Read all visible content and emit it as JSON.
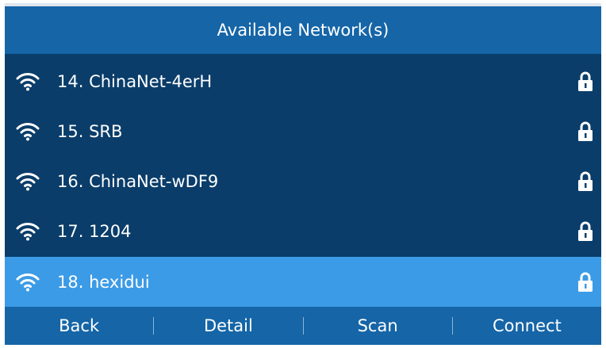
{
  "header": {
    "title": "Available Network(s)"
  },
  "networks": [
    {
      "label": "14.  ChinaNet-4erH",
      "icon": "wifi-icon",
      "secured": true
    },
    {
      "label": "15.  SRB",
      "icon": "wifi-icon",
      "secured": true
    },
    {
      "label": "16.  ChinaNet-wDF9",
      "icon": "wifi-icon",
      "secured": true
    },
    {
      "label": "17.  1204",
      "icon": "wifi-icon",
      "secured": true
    },
    {
      "label": "18.  hexidui",
      "icon": "wifi-icon",
      "secured": true,
      "selected": true
    }
  ],
  "softkeys": {
    "back": "Back",
    "detail": "Detail",
    "scan": "Scan",
    "connect": "Connect"
  },
  "colors": {
    "background": "#0a3d6a",
    "header": "#1565a7",
    "selected": "#3c9be6",
    "text": "#ffffff"
  }
}
